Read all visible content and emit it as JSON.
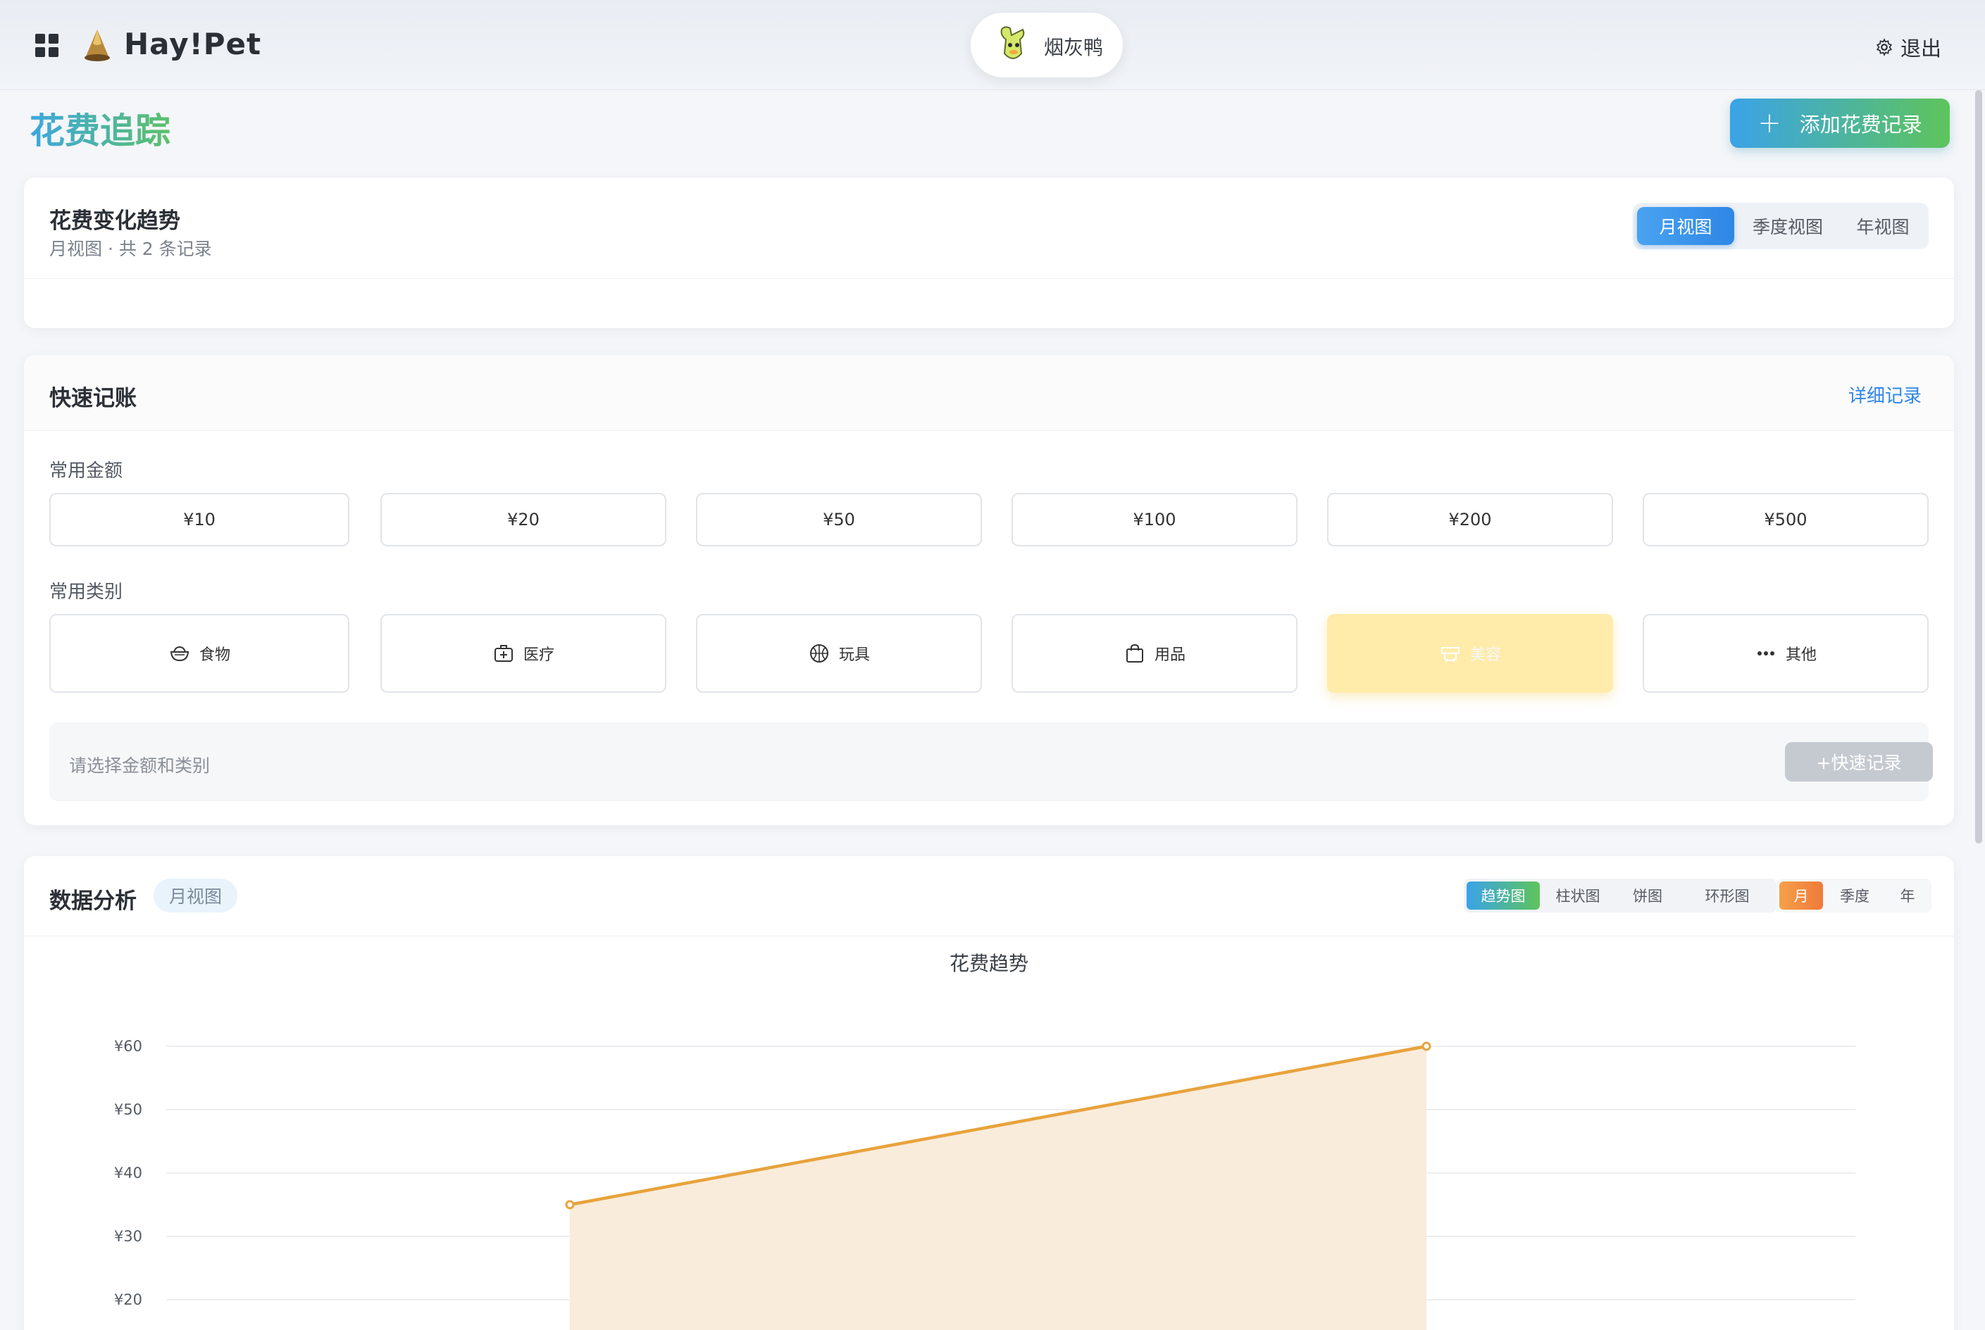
{
  "header": {
    "brand": "Hay!Pet",
    "pet_name": "烟灰鸭",
    "logout": "退出"
  },
  "page": {
    "title": "花费追踪",
    "add_button": "添加花费记录"
  },
  "trend_card": {
    "title": "花费变化趋势",
    "subtitle": "月视图 · 共 2 条记录",
    "views": [
      "月视图",
      "季度视图",
      "年视图"
    ],
    "active_view": "月视图"
  },
  "quick": {
    "title": "快速记账",
    "detail_link": "详细记录",
    "amount_label": "常用金额",
    "amounts": [
      "¥10",
      "¥20",
      "¥50",
      "¥100",
      "¥200",
      "¥500"
    ],
    "category_label": "常用类别",
    "categories": [
      {
        "label": "食物",
        "icon": "food-bowl-icon"
      },
      {
        "label": "医疗",
        "icon": "medical-kit-icon"
      },
      {
        "label": "玩具",
        "icon": "ball-icon"
      },
      {
        "label": "用品",
        "icon": "shopping-bag-icon"
      },
      {
        "label": "美容",
        "icon": "bath-icon",
        "selected": true
      },
      {
        "label": "其他",
        "icon": "more-dots-icon"
      }
    ],
    "hint": "请选择金额和类别",
    "submit": "+快速记录"
  },
  "analysis": {
    "title": "数据分析",
    "view_tag": "月视图",
    "chart_types": [
      "趋势图",
      "柱状图",
      "饼图",
      "环形图"
    ],
    "active_chart_type": "趋势图",
    "periods": [
      "月",
      "季度",
      "年"
    ],
    "active_period": "月"
  },
  "colors": {
    "accent_blue": "#2f86e6",
    "accent_green": "#5ec45b",
    "line": "#e8a33d",
    "area": "#f9ecdb",
    "selected_category": "#ffecaa"
  },
  "chart_data": {
    "type": "area",
    "title": "花费趋势",
    "ytick_labels": [
      "¥20",
      "¥30",
      "¥40",
      "¥50",
      "¥60"
    ],
    "y_ticks": [
      20,
      30,
      40,
      50,
      60
    ],
    "ylim": [
      20,
      60
    ],
    "series": [
      {
        "values": [
          35,
          60
        ]
      }
    ],
    "grid": true
  }
}
